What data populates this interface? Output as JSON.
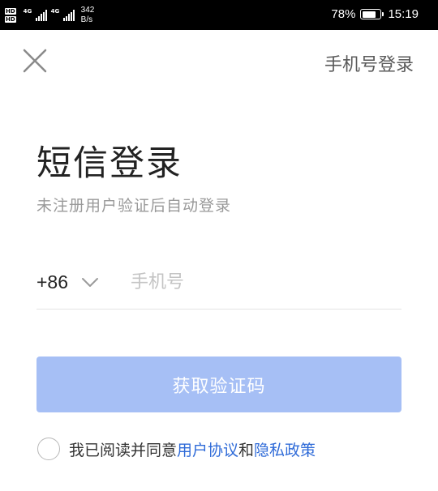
{
  "status_bar": {
    "sim1": "HD",
    "sim2": "HD",
    "net1": "4G",
    "net2": "4G",
    "speed_value": "342",
    "speed_unit": "B/s",
    "battery_percent": "78%",
    "battery_level": 0.78,
    "time": "15:19"
  },
  "header": {
    "close_icon": "close-icon",
    "alt_login_label": "手机号登录"
  },
  "main": {
    "title": "短信登录",
    "subtitle": "未注册用户验证后自动登录",
    "country_code": "+86",
    "phone_placeholder": "手机号",
    "phone_value": "",
    "get_code_label": "获取验证码",
    "get_code_color": "#a6bff5"
  },
  "agreement": {
    "prefix": "我已阅读并同意",
    "user_agreement": "用户协议",
    "and": "和",
    "privacy_policy": "隐私政策",
    "link_color": "#2f6bd8",
    "checked": false
  }
}
